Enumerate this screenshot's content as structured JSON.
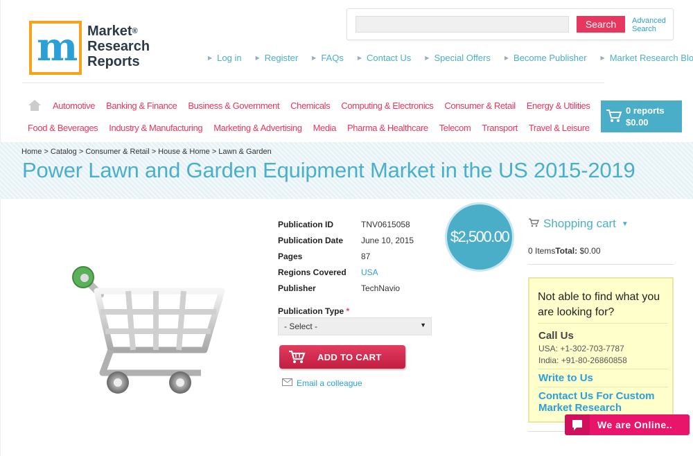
{
  "logo": {
    "line1": "Market",
    "line2": "Research",
    "line3": "Reports",
    "reg": "®"
  },
  "search": {
    "placeholder": "",
    "button_label": "Search",
    "advanced_line1": "Advanced",
    "advanced_line2": "Search"
  },
  "top_links": [
    "Log in",
    "Register",
    "FAQs",
    "Contact Us",
    "Special Offers",
    "Become Publisher",
    "Market Research Blog"
  ],
  "categories_row1": [
    "Automotive",
    "Banking & Finance",
    "Business & Government",
    "Chemicals",
    "Computing & Electronics",
    "Consumer & Retail",
    "Energy & Utilities"
  ],
  "categories_row2": [
    "Food & Beverages",
    "Industry & Manufacturing",
    "Marketing & Advertising",
    "Media",
    "Pharma & Healthcare",
    "Telecom",
    "Transport",
    "Travel & Leisure"
  ],
  "header_cart": {
    "reports": "0 reports",
    "total": "$0.00"
  },
  "breadcrumb": "Home > Catalog > Consumer & Retail > House & Home > Lawn & Garden",
  "page_title": "Power Lawn and Garden Equipment Market in the US 2015-2019",
  "details": [
    {
      "label": "Publication ID",
      "value": "TNV0615058",
      "link": false
    },
    {
      "label": "Publication Date",
      "value": "June 10, 2015",
      "link": false
    },
    {
      "label": "Pages",
      "value": "87",
      "link": false
    },
    {
      "label": "Regions Covered",
      "value": "USA",
      "link": true
    },
    {
      "label": "Publisher",
      "value": "TechNavio",
      "link": false
    }
  ],
  "price": "$2,500.00",
  "publication_type": {
    "label": "Publication Type",
    "required_mark": "*",
    "selected": "- Select -"
  },
  "add_to_cart_label": "ADD TO CART",
  "email_label": "Email a colleague",
  "shopping_cart": {
    "title": "Shopping cart",
    "items": "0 Items",
    "total_label": "Total:",
    "total_value": "$0.00"
  },
  "help": {
    "question": "Not able to find what you are looking for?",
    "call_heading": "Call Us",
    "usa": "USA: +1-302-703-7787",
    "india": "India: +91-80-26860858",
    "write": "Write to Us",
    "custom": "Contact Us For Custom Market Research"
  },
  "chat": {
    "label": "We are Online.."
  },
  "colors": {
    "accent_blue": "#4aaec9",
    "accent_pink": "#e8375f",
    "logo_orange": "#f7a21b"
  },
  "icons": [
    "home-icon",
    "cart-icon",
    "envelope-icon",
    "chat-icon",
    "chevron-down-icon"
  ]
}
